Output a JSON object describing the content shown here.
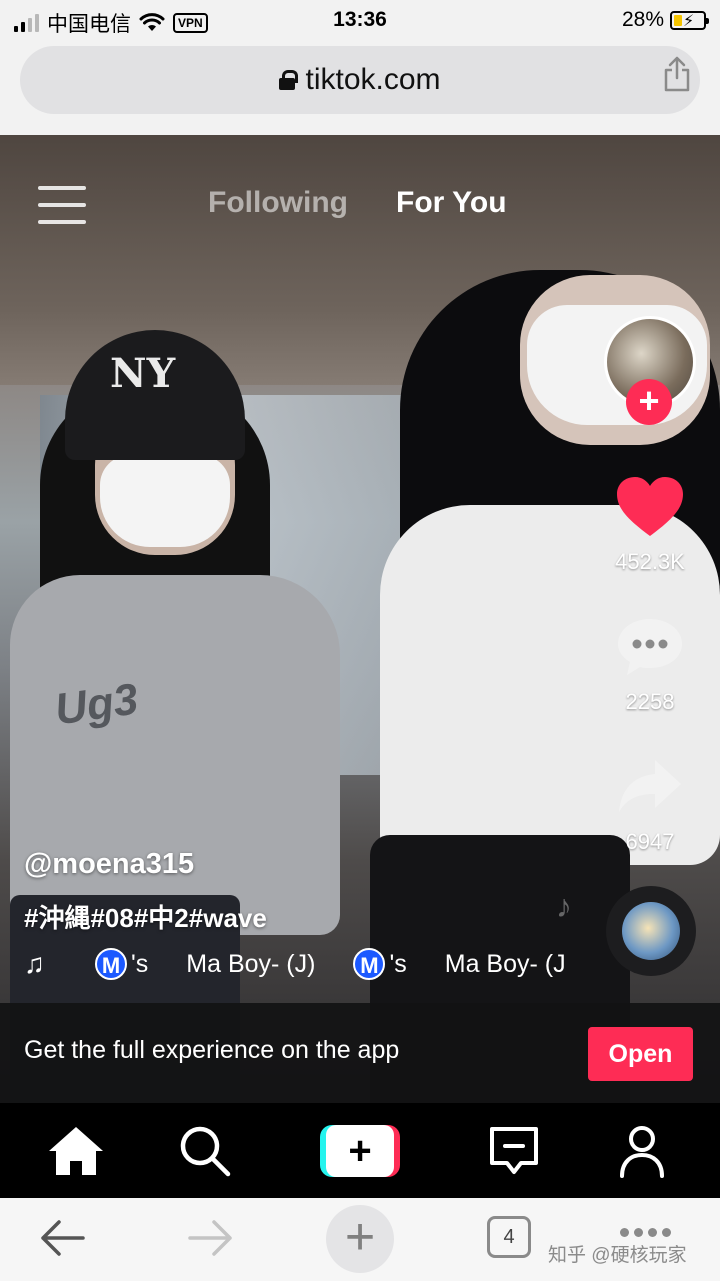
{
  "status_bar": {
    "carrier": "中国电信",
    "vpn": "VPN",
    "time": "13:36",
    "battery_percent": "28%",
    "battery_level": 0.28
  },
  "browser": {
    "url": "tiktok.com",
    "tabs_count": "4"
  },
  "feed": {
    "tab_following": "Following",
    "tab_for_you": "For You",
    "active_tab": "For You"
  },
  "video": {
    "shirt_print": "Ug3",
    "cap_logo": "NY"
  },
  "actions": {
    "likes": "452.3K",
    "comments": "2258",
    "shares": "6947"
  },
  "caption": {
    "username": "@moena315",
    "hashtags": "#沖縄#08#中2#wave",
    "music_parts": [
      {
        "badge": "M",
        "text": "'s"
      },
      {
        "text": "Ma Boy- (J)"
      },
      {
        "badge": "M",
        "text": "'s"
      },
      {
        "text": "Ma Boy- (J)"
      }
    ]
  },
  "banner": {
    "text": "Get the full experience on the app",
    "button": "Open"
  },
  "watermark": "知乎 @硬核玩家",
  "colors": {
    "accent": "#fe2c55",
    "cyan": "#25f4ee",
    "tabbar": "#000000"
  }
}
